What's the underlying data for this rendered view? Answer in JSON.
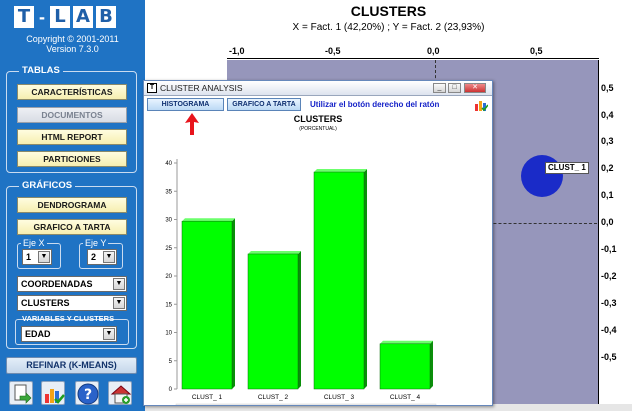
{
  "app": {
    "logo_letters": [
      "T",
      "L",
      "A",
      "B"
    ],
    "copyright": "Copyright © 2001-2011",
    "version": "Version 7.3.0"
  },
  "tablas": {
    "title": "TABLAS",
    "buttons": [
      "CARACTERÍSTICAS",
      "DOCUMENTOS",
      "HTML REPORT",
      "PARTICIONES"
    ]
  },
  "graficos": {
    "title": "GRÁFICOS",
    "buttons": [
      "DENDROGRAMA",
      "GRAFICO A TARTA"
    ],
    "eje_x_label": "Eje X",
    "eje_x_value": "1",
    "eje_y_label": "Eje Y",
    "eje_y_value": "2",
    "coord_value": "COORDENADAS",
    "clusters_value": "CLUSTERS",
    "vars_title": "VARIABLES Y CLUSTERS",
    "vars_value": "EDAD"
  },
  "refinar_label": "REFINAR (K-MEANS)",
  "bottom_icons": [
    "document-export-icon",
    "chart-check-icon",
    "help-icon",
    "home-icon"
  ],
  "main": {
    "title": "CLUSTERS",
    "subtitle": "X = Fact. 1 (42,20%) ; Y = Fact. 2 (23,93%)",
    "x_ticks": [
      "-1,0",
      "-0,5",
      "0,0",
      "0,5"
    ],
    "y_ticks": [
      "0,5",
      "0,4",
      "0,3",
      "0,2",
      "0,1",
      "0,0",
      "-0,1",
      "-0,2",
      "-0,3",
      "-0,4",
      "-0,5"
    ],
    "cluster_label": "CLUST_ 1",
    "plot_color": "#9696bb",
    "dot_color": "#1a2bc8"
  },
  "dialog": {
    "title": "CLUSTER ANALYSIS",
    "tabs": [
      "HISTOGRAMA",
      "GRAFICO A TARTA"
    ],
    "hint": "Utilizar el botón derecho del ratón"
  },
  "chart_data": {
    "type": "bar",
    "title": "CLUSTERS",
    "subtitle": "(PORCENTUAL)",
    "categories": [
      "CLUST_ 1",
      "CLUST_ 2",
      "CLUST_ 3",
      "CLUST_ 4"
    ],
    "values": [
      29.7,
      23.9,
      38.4,
      8.0
    ],
    "value_labels": [
      "29,7",
      "23,9",
      "38,4",
      "8,0"
    ],
    "ylim": [
      0,
      40
    ],
    "y_ticks": [
      0,
      5,
      10,
      15,
      20,
      25,
      30,
      35,
      40
    ],
    "bar_color": "#00ff00",
    "grid": false
  }
}
